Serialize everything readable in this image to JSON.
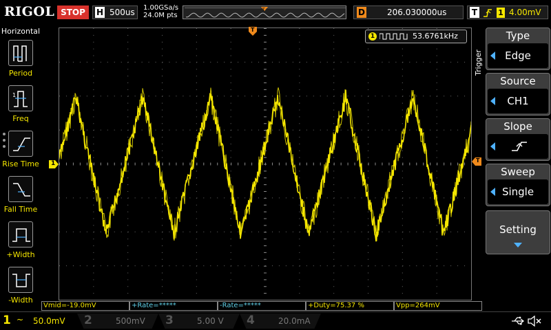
{
  "topbar": {
    "logo": "RIGOL",
    "run_state": "STOP",
    "horizontal_letter": "H",
    "timebase": "500us",
    "sample_rate": "1.00GSa/s",
    "memory_depth": "24.0M pts",
    "delay_letter": "D",
    "delay": "206.030000us",
    "trigger_letter": "T",
    "trigger_channel": "1",
    "trigger_level": "4.00mV",
    "colors": {
      "stop": "#d8322c",
      "ch1": "#f5e600",
      "trigger_marker": "#f08a1c"
    }
  },
  "left_menu": {
    "title": "Horizontal",
    "items": [
      {
        "label": "Period",
        "icon": "period-icon"
      },
      {
        "label": "Freq",
        "icon": "freq-icon"
      },
      {
        "label": "Rise Time",
        "icon": "rise-time-icon"
      },
      {
        "label": "Fall Time",
        "icon": "fall-time-icon"
      },
      {
        "label": "+Width",
        "icon": "positive-width-icon"
      },
      {
        "label": "-Width",
        "icon": "negative-width-icon"
      }
    ]
  },
  "waveform": {
    "trigger_marker_top": "T",
    "ch1_level_marker": "1",
    "trigger_level_marker": "T",
    "frequency_readout": {
      "channel": "1",
      "value": "53.6761kHz"
    }
  },
  "right_menu": {
    "vertical_title": "Trigger",
    "type": {
      "title": "Type",
      "value": "Edge"
    },
    "source": {
      "title": "Source",
      "value": "CH1"
    },
    "slope": {
      "title": "Slope",
      "icon": "rising-edge-icon"
    },
    "sweep": {
      "title": "Sweep",
      "value": "Single"
    },
    "setting": {
      "title": "Setting"
    }
  },
  "measurements": [
    {
      "text": "Vmid=-19.0mV",
      "color": "#f5e600"
    },
    {
      "text": "+Rate=*****",
      "color": "#5fd0e8"
    },
    {
      "text": "-Rate=*****",
      "color": "#5fd0e8"
    },
    {
      "text": "+Duty=75.37 %",
      "color": "#f5e600"
    },
    {
      "text": "Vpp=264mV",
      "color": "#f5e600"
    }
  ],
  "channels": [
    {
      "num": "1",
      "coupling": "~",
      "scale": "50.0mV",
      "color": "#f5e600",
      "active": true
    },
    {
      "num": "2",
      "coupling": "",
      "scale": "500mV",
      "color": "#3a9c7a",
      "active": false
    },
    {
      "num": "3",
      "coupling": "",
      "scale": "5.00 V",
      "color": "#c0389a",
      "active": false
    },
    {
      "num": "4",
      "coupling": "",
      "scale": "20.0mA",
      "color": "#2d6fc4",
      "active": false
    }
  ],
  "status_icons": {
    "usb": "usb-icon",
    "sound": "speaker-muted-icon"
  }
}
